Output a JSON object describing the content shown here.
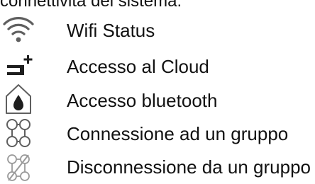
{
  "intro_text": "connettività del sistema:",
  "legend": [
    {
      "icon": "wifi-icon",
      "label": "Wifi Status"
    },
    {
      "icon": "cloud-access-icon",
      "label": "Accesso al Cloud"
    },
    {
      "icon": "bluetooth-drop-icon",
      "label": "Accesso bluetooth"
    },
    {
      "icon": "group-connect-icon",
      "label": "Connessione ad un gruppo"
    },
    {
      "icon": "group-disconnect-icon",
      "label": "Disconnessione da un gruppo"
    }
  ],
  "colors": {
    "text": "#111111",
    "icon": "#5f5f5f",
    "icon_light": "#9a9a9a"
  }
}
